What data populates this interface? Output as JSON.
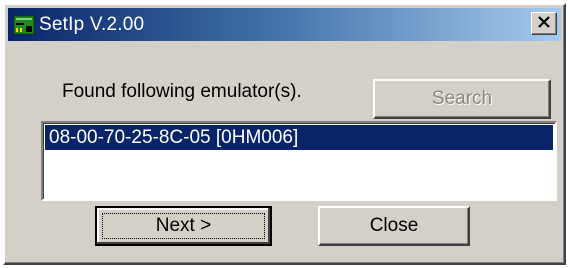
{
  "window": {
    "title": "SetIp V.2.00",
    "icon": "network-board-icon",
    "close_glyph": "×"
  },
  "main": {
    "found_label": "Found following emulator(s).",
    "search_label": "Search",
    "emulators": [
      "08-00-70-25-8C-05 [0HM006]"
    ],
    "next_label": "Next >",
    "close_label": "Close"
  },
  "colors": {
    "title_bar_start": "#0a246a",
    "title_bar_end": "#a6caf0",
    "dialog_face": "#d4d0c8",
    "selection": "#0a246a"
  }
}
